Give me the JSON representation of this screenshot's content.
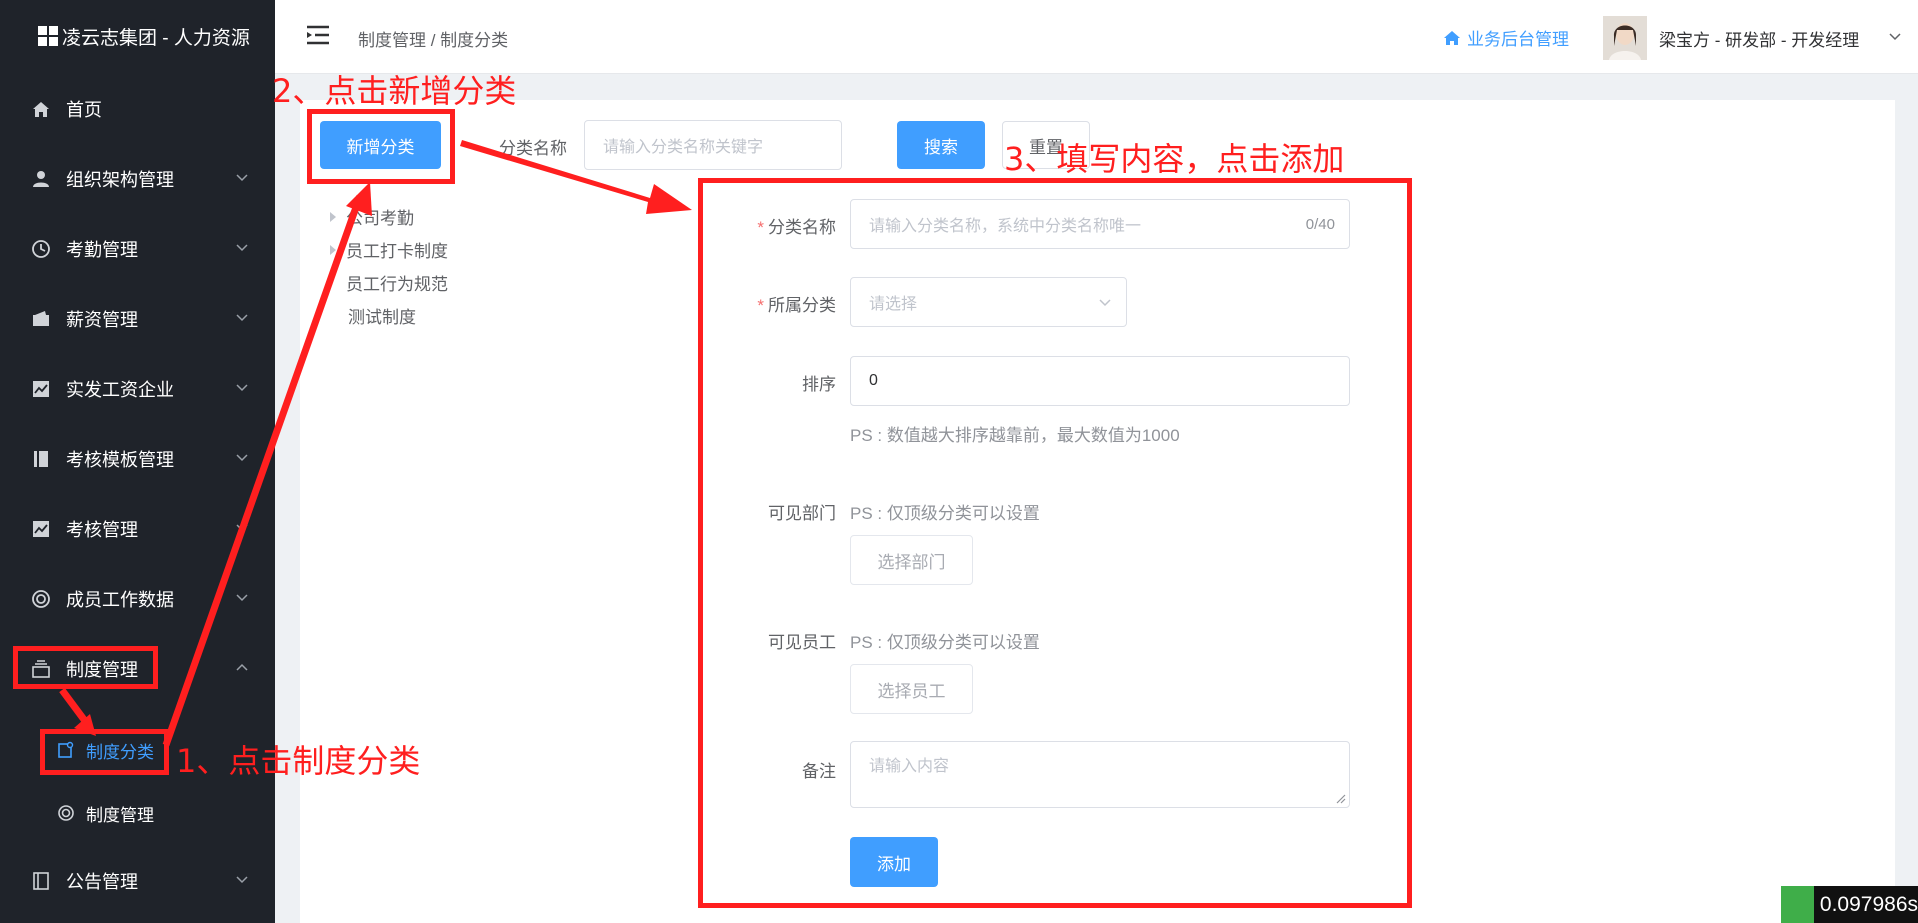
{
  "brand": {
    "title": "凌云志集团 - 人力资源"
  },
  "sidebar": {
    "items": [
      {
        "label": "首页",
        "icon": "home-icon"
      },
      {
        "label": "组织架构管理",
        "icon": "user-icon"
      },
      {
        "label": "考勤管理",
        "icon": "clock-icon"
      },
      {
        "label": "薪资管理",
        "icon": "wallet-icon"
      },
      {
        "label": "实发工资企业",
        "icon": "chart-icon"
      },
      {
        "label": "考核模板管理",
        "icon": "book-icon"
      },
      {
        "label": "考核管理",
        "icon": "chart-icon"
      },
      {
        "label": "成员工作数据",
        "icon": "lifebuoy-icon"
      },
      {
        "label": "制度管理",
        "icon": "stack-icon"
      },
      {
        "label": "公告管理",
        "icon": "notebook-icon"
      }
    ],
    "sub_items": [
      {
        "label": "制度分类",
        "icon": "edit-icon"
      },
      {
        "label": "制度管理",
        "icon": "lifebuoy-icon"
      }
    ]
  },
  "header": {
    "breadcrumb": "制度管理 / 制度分类",
    "biz_link": "业务后台管理",
    "user": "梁宝方 - 研发部 - 开发经理"
  },
  "toolbar": {
    "add_button": "新增分类",
    "name_label": "分类名称",
    "search_placeholder": "请输入分类名称关键字",
    "search_button": "搜索",
    "reset_button": "重置"
  },
  "tree": {
    "items": [
      "公司考勤",
      "员工打卡制度",
      "员工行为规范",
      "测试制度"
    ]
  },
  "form": {
    "name_label": "分类名称",
    "name_placeholder": "请输入分类名称，系统中分类名称唯一",
    "name_counter": "0/40",
    "parent_label": "所属分类",
    "parent_placeholder": "请选择",
    "sort_label": "排序",
    "sort_value": "0",
    "sort_hint": "PS : 数值越大排序越靠前，最大数值为1000",
    "dept_label": "可见部门",
    "dept_hint": "PS : 仅顶级分类可以设置",
    "dept_button": "选择部门",
    "staff_label": "可见员工",
    "staff_hint": "PS : 仅顶级分类可以设置",
    "staff_button": "选择员工",
    "remark_label": "备注",
    "remark_placeholder": "请输入内容",
    "submit_button": "添加"
  },
  "annotations": {
    "step1": "1、点击制度分类",
    "step2": "2、点击新增分类",
    "step3": "3、填写内容，点击添加"
  },
  "timer": "0.097986s",
  "colors": {
    "accent": "#409eff",
    "sidebar": "#1f232a",
    "annotation": "#ff1f1f"
  }
}
